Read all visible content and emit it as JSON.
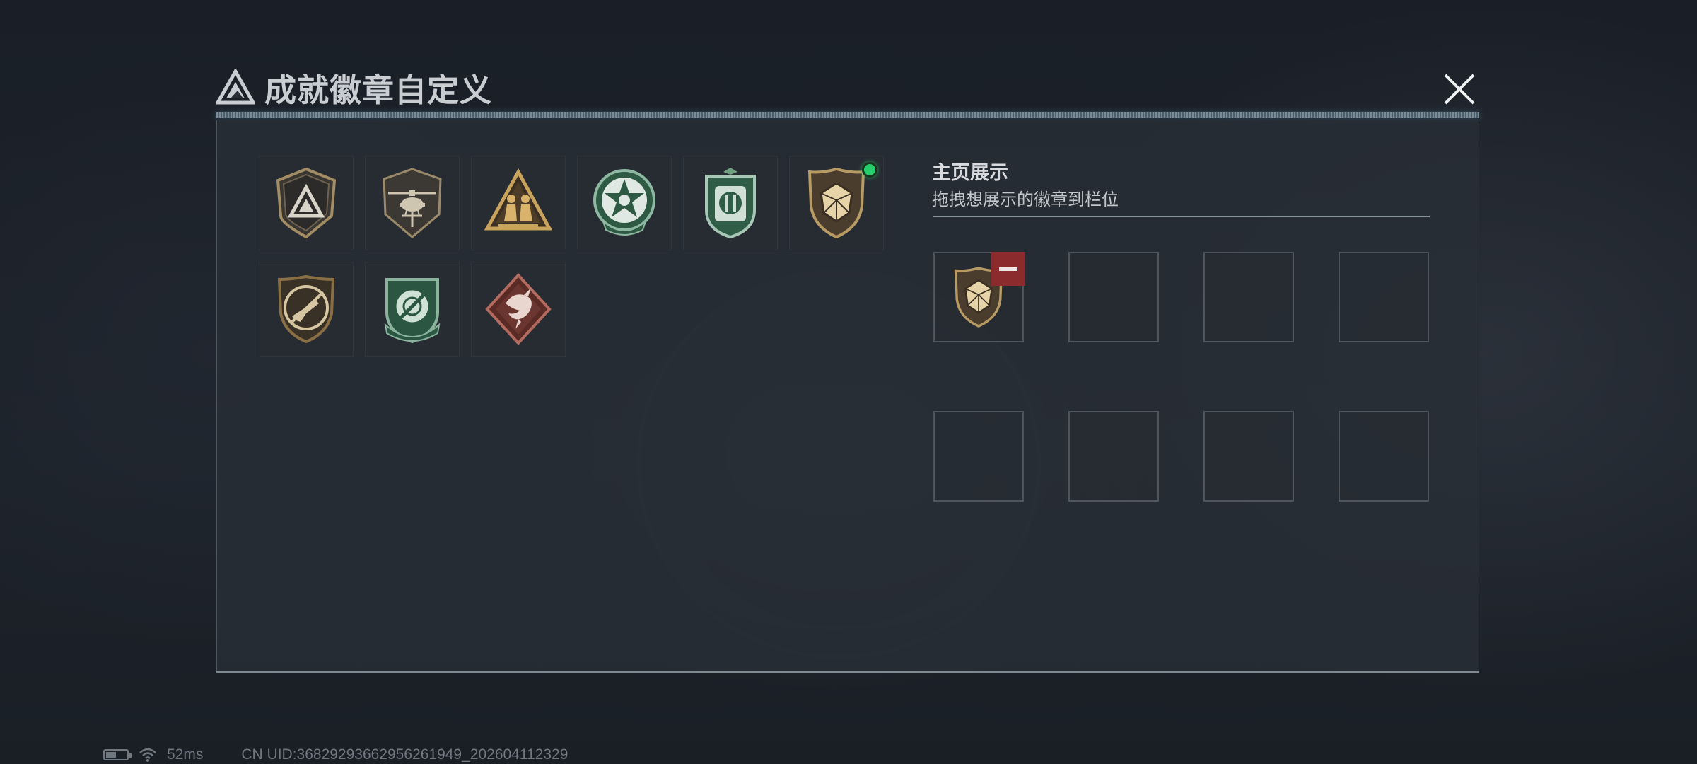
{
  "header": {
    "title": "成就徽章自定义",
    "close_icon": "close-icon"
  },
  "badges": [
    {
      "name": "triangle-shield-badge",
      "color": "#8a7a5a",
      "new": false
    },
    {
      "name": "helicopter-badge",
      "color": "#8a7a5a",
      "new": false
    },
    {
      "name": "soldiers-triangle-badge",
      "color": "#c9a25b",
      "new": false
    },
    {
      "name": "green-star-badge",
      "color": "#3d6e52",
      "new": false
    },
    {
      "name": "green-shield-badge",
      "color": "#3d6e52",
      "new": false
    },
    {
      "name": "gem-shield-badge",
      "color": "#b89a63",
      "new": true
    },
    {
      "name": "rifle-shield-badge",
      "color": "#8a6f45",
      "new": false
    },
    {
      "name": "green-crosshair-badge",
      "color": "#3d6e52",
      "new": false
    },
    {
      "name": "dragon-diamond-badge",
      "color": "#7a3b35",
      "new": false
    }
  ],
  "showcase": {
    "title": "主页展示",
    "subtitle": "拖拽想展示的徽章到栏位",
    "slots": [
      {
        "filled": true,
        "badge": "gem-shield-badge"
      },
      {
        "filled": false
      },
      {
        "filled": false
      },
      {
        "filled": false
      },
      {
        "filled": false
      },
      {
        "filled": false
      },
      {
        "filled": false
      },
      {
        "filled": false
      }
    ],
    "remove_icon": "minus-icon"
  },
  "status_bar": {
    "ping": "52ms",
    "uid": "CN UID:3682929366295626194​9_202604112329",
    "battery_icon": "battery-icon",
    "wifi_icon": "wifi-icon"
  },
  "colors": {
    "accent_new": "#25d06c",
    "remove_red": "#8b2b2e",
    "panel_bg": "#282e36"
  }
}
